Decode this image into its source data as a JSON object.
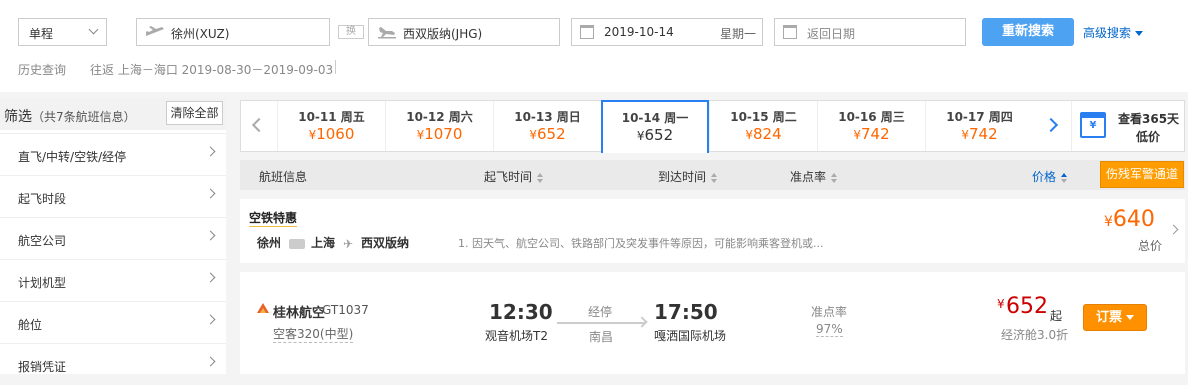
{
  "search": {
    "trip_type": "单程",
    "from_city": "徐州(XUZ)",
    "swap_label": "换",
    "to_city": "西双版纳(JHG)",
    "depart_date": "2019-10-14",
    "depart_weekday": "星期一",
    "return_placeholder": "返回日期",
    "search_button": "重新搜索",
    "advanced_label": "高级搜索"
  },
  "history": {
    "label": "历史查询",
    "item": "往返 上海－海口 2019-08-30－2019-09-03"
  },
  "filters": {
    "title": "筛选",
    "subtitle": "（共7条航班信息）",
    "clear_label": "清除全部",
    "items": [
      "直飞/中转/空铁/经停",
      "起飞时段",
      "航空公司",
      "计划机型",
      "舱位",
      "报销凭证"
    ]
  },
  "dates": {
    "cells": [
      {
        "date": "10-11 周五",
        "price": "1060"
      },
      {
        "date": "10-12 周六",
        "price": "1070"
      },
      {
        "date": "10-13 周日",
        "price": "652"
      },
      {
        "date": "10-14 周一",
        "price": "652",
        "active": true
      },
      {
        "date": "10-15 周二",
        "price": "824"
      },
      {
        "date": "10-16 周三",
        "price": "742"
      },
      {
        "date": "10-17 周四",
        "price": "742"
      }
    ],
    "currency": "¥",
    "calendar_line1": "查看365天",
    "calendar_line2": "低价",
    "calendar_icon_text": "¥"
  },
  "table_header": {
    "flight_info": "航班信息",
    "depart_time": "起飞时间",
    "arrive_time": "到达时间",
    "on_time": "准点率",
    "price": "价格",
    "channel_button": "伤残军警通道"
  },
  "air_rail": {
    "title": "空铁特惠",
    "from": "徐州",
    "via": "上海",
    "to": "西双版纳",
    "note": "1. 因天气、航空公司、铁路部门及突发事件等原因，可能影响乘客登机或...",
    "currency": "¥",
    "price": "640",
    "price_label": "总价"
  },
  "flight": {
    "airline": "桂林航空",
    "flight_no": "GT1037",
    "aircraft": "空客320(中型)",
    "depart_time": "12:30",
    "depart_airport": "观音机场T2",
    "stop_label": "经停",
    "stop_city": "南昌",
    "arrive_time": "17:50",
    "arrive_airport": "嘎洒国际机场",
    "on_time_label": "准点率",
    "on_time_value": "97%",
    "currency": "¥",
    "price": "652",
    "price_suffix": "起",
    "cabin_discount": "经济舱3.0折",
    "book_button": "订票"
  }
}
